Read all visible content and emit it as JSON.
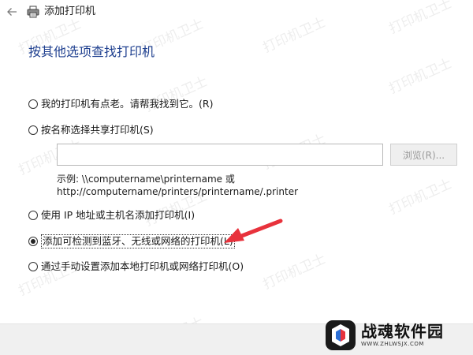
{
  "window": {
    "title": "添加打印机"
  },
  "main": {
    "heading": "按其他选项查找打印机",
    "options": [
      {
        "label": "我的打印机有点老。请帮我找到它。(R)",
        "checked": false
      },
      {
        "label": "按名称选择共享打印机(S)",
        "checked": false
      },
      {
        "label": "使用 IP 地址或主机名添加打印机(I)",
        "checked": false
      },
      {
        "label": "添加可检测到蓝牙、无线或网络的打印机(L)",
        "checked": true
      },
      {
        "label": "通过手动设置添加本地打印机或网络打印机(O)",
        "checked": false
      }
    ],
    "share_input": {
      "value": "",
      "placeholder": ""
    },
    "browse_label": "浏览(R)...",
    "example_line1": "示例: \\\\computername\\printername 或",
    "example_line2": "http://computername/printers/printername/.printer"
  },
  "watermark": "打印机卫士",
  "logo": {
    "title": "战魂软件园",
    "subtitle": "WWW.ZHLWSJX.COM"
  },
  "colors": {
    "heading": "#1e3f8f",
    "arrow": "#e8323c",
    "bottom_bar": "#f0f0f0"
  },
  "icons": {
    "back": "back-arrow-icon",
    "printer": "printer-icon"
  }
}
